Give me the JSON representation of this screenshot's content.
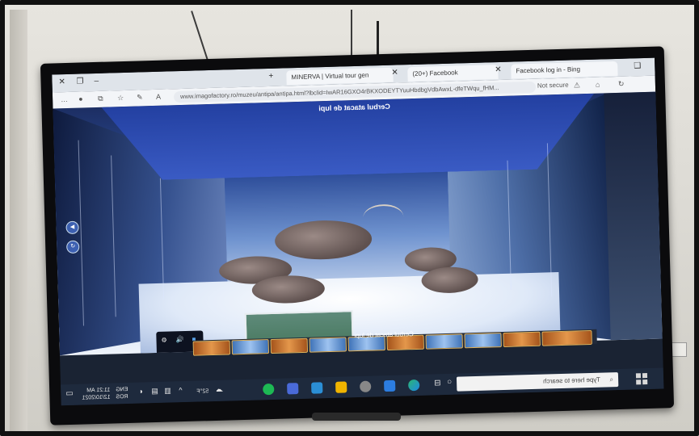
{
  "browser": {
    "tabs": [
      {
        "label": "Facebook log in - Bing"
      },
      {
        "label": "(20+) Facebook"
      },
      {
        "label": "MINERVA | Virtual tour gen"
      }
    ],
    "address": {
      "security_label": "Not secure",
      "url": "www.imagofactory.ro/muzeu/antipa/antipa.html?lbclid=IwAR16GXO4rBKXODEYTYuuHbdbgVdbAwxL-dfeTWqu_fHM..."
    }
  },
  "tour": {
    "scene_title": "Cerbul atacat de lupi",
    "thumbnail_label": "Cerbul atacat de lupi"
  },
  "taskbar": {
    "search_placeholder": "Type here to search",
    "time": "11:21 AM",
    "date": "12/10/2021",
    "weather": "52°F",
    "language": "ENG",
    "region": "ROS"
  },
  "colors": {
    "accent": "#2f4f9b",
    "taskbar": "#1e2a3d",
    "thumb_border": "#e1b25a"
  }
}
